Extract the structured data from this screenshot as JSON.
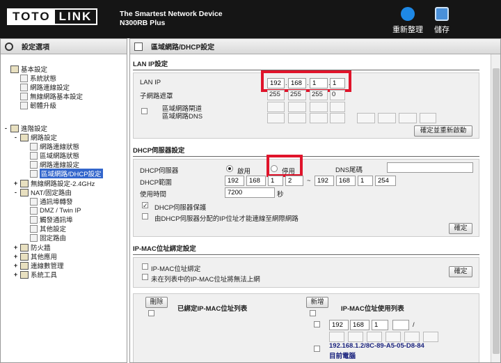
{
  "header": {
    "logo_left": "TOTO",
    "logo_right": "LINK",
    "tagline1": "The Smartest Network Device",
    "tagline2": "N300RB Plus",
    "refresh_label": "重新整理",
    "save_label": "儲存"
  },
  "left_panel": {
    "title": "設定選項",
    "basic": {
      "label": "基本設定",
      "items": [
        "系統狀態",
        "網路連線設定",
        "無線網路基本設定",
        "韌體升級"
      ]
    },
    "advanced": {
      "label": "進階設定",
      "network": {
        "label": "網路設定",
        "items": [
          "網路連線狀態",
          "區域網路狀態",
          "網路連線設定",
          "區域網路/DHCP設定"
        ]
      },
      "wireless": "無線網路設定-2.4GHz",
      "nat": {
        "label": "NAT/固定路由",
        "items": [
          "通訊埠轉發",
          "DMZ / Twin IP",
          "觸發通訊埠",
          "其他設定",
          "固定路由"
        ]
      },
      "firewall": "防火牆",
      "other": "其他應用",
      "traffic": "連線數管理",
      "system": "系統工具"
    }
  },
  "right_panel": {
    "title": "區域網路/DHCP設定",
    "lan": {
      "section": "LAN IP設定",
      "ip_label": "LAN IP",
      "ip": [
        "192",
        "168",
        "1",
        "1"
      ],
      "mask_label": "子網路遮罩",
      "mask": [
        "255",
        "255",
        "255",
        "0"
      ],
      "gw_label": "區域網路閘道",
      "dns_label": "區域網路DNS",
      "apply_button": "確定並重新啟動"
    },
    "dhcp": {
      "section": "DHCP伺服器設定",
      "server_label": "DHCP伺服器",
      "enable": "啟用",
      "disable": "停用",
      "dns_suffix_label": "DNS尾碼",
      "range_label": "DHCP範圍",
      "range_start": [
        "192",
        "168",
        "1",
        "2"
      ],
      "tilde": "~",
      "range_end": [
        "192",
        "168",
        "1",
        "254"
      ],
      "lease_label": "使用時間",
      "lease": "7200",
      "lease_unit": "秒",
      "protect_label": "DHCP伺服器保護",
      "only_dhcp_label": "由DHCP伺服器分配的IP位址才能連線至網際網路",
      "ok_button": "確定"
    },
    "ipmac": {
      "section": "IP-MAC位址綁定設定",
      "bind_label": "IP-MAC位址綁定",
      "block_label": "未在列表中的IP-MAC位址將無法上網",
      "ok_button": "確定",
      "delete_button": "刪除",
      "bound_list_label": "已綁定IP-MAC位址列表",
      "add_button": "新增",
      "used_list_label": "IP-MAC位址使用列表",
      "new_ip": [
        "192",
        "168",
        "1",
        ""
      ],
      "slash": "/",
      "client_entry": "192.168.1.2/8C-89-A5-05-D8-84",
      "client_name": "目前電腦"
    }
  },
  "colors": {
    "header_bg": "#151515",
    "highlight": "#e0142b",
    "selected": "#3366cc"
  }
}
